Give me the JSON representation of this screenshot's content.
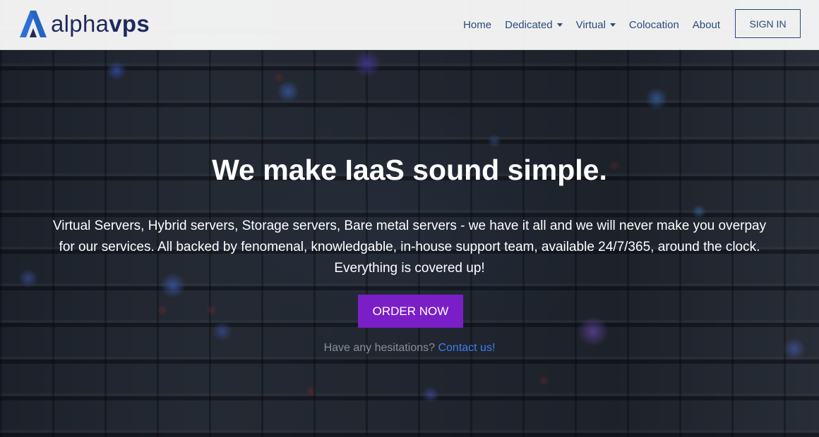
{
  "brand": {
    "name_light": "alpha",
    "name_bold": "vps",
    "colors": {
      "primary": "#1d2a5c",
      "accent": "#2f6fd4",
      "button": "#7a1fc8",
      "link": "#3f7ff0"
    }
  },
  "nav": {
    "items": [
      {
        "label": "Home",
        "has_dropdown": false
      },
      {
        "label": "Dedicated",
        "has_dropdown": true
      },
      {
        "label": "Virtual",
        "has_dropdown": true
      },
      {
        "label": "Colocation",
        "has_dropdown": false
      },
      {
        "label": "About",
        "has_dropdown": false
      }
    ],
    "signin_label": "SIGN IN"
  },
  "hero": {
    "title": "We make IaaS sound simple.",
    "description_line1": "Virtual Servers, Hybrid servers, Storage servers, Bare metal servers - we have it all and we will never make you overpay",
    "description_line2": "for our services. All backed by fenomenal, knowledgable, in-house support team, available 24/7/365, around the clock.",
    "description_line3": "Everything is covered up!",
    "cta_label": "ORDER NOW",
    "hesitation_text": "Have any hesitations?",
    "contact_link": "Contact us!"
  },
  "icons": {
    "logo": "alphavps-logo-mark",
    "dropdown": "caret-down-icon"
  }
}
